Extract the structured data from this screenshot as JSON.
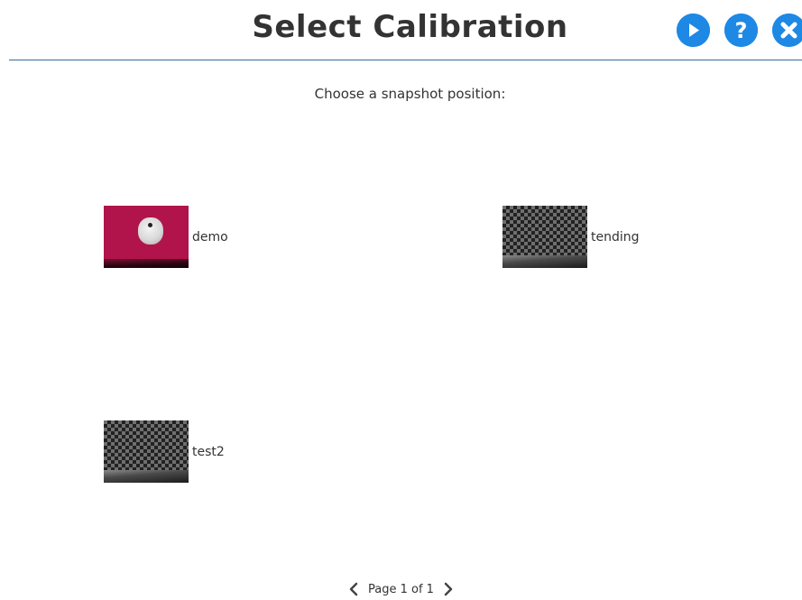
{
  "header": {
    "title": "Select Calibration",
    "buttons": {
      "play_icon": "play-icon",
      "help_icon": "question-icon",
      "close_icon": "close-icon"
    }
  },
  "main": {
    "prompt": "Choose a snapshot position:",
    "snapshots": [
      {
        "name": "demo",
        "thumbnail": "pink-background-with-disc"
      },
      {
        "name": "tending",
        "thumbnail": "checkerboard"
      },
      {
        "name": "test2",
        "thumbnail": "checkerboard"
      }
    ]
  },
  "pagination": {
    "text": "Page 1 of 1",
    "prev_icon": "chevron-left-icon",
    "next_icon": "chevron-right-icon"
  },
  "colors": {
    "accent": "#1e88e5",
    "divider": "#3b6a9a",
    "text": "#333333"
  }
}
